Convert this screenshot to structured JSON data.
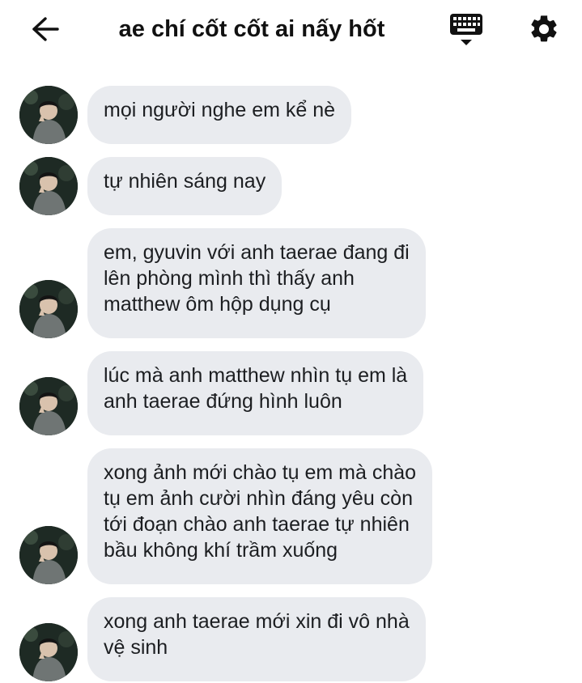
{
  "header": {
    "title": "ae chí cốt cốt ai nấy hốt"
  },
  "icons": {
    "back": "arrow-left-icon",
    "keyboard": "keyboard-icon",
    "settings": "gear-icon"
  },
  "colors": {
    "bubble_background": "#e9ebef",
    "text": "#1c1e21",
    "background": "#ffffff"
  },
  "messages": [
    {
      "text": "mọi người nghe em kể nè"
    },
    {
      "text": "tự nhiên sáng nay"
    },
    {
      "text": "em, gyuvin với anh taerae đang đi\nlên phòng mình thì thấy anh\nmatthew ôm hộp dụng cụ"
    },
    {
      "text": "lúc mà anh matthew nhìn tụ em là\nanh taerae đứng hình luôn"
    },
    {
      "text": "xong ảnh mới chào tụ em mà chào\ntụ em ảnh cười nhìn đáng yêu còn\ntới đoạn chào anh taerae tự nhiên\nbầu không khí trầm xuống"
    },
    {
      "text": "xong anh taerae mới xin đi vô nhà\nvệ sinh"
    }
  ]
}
